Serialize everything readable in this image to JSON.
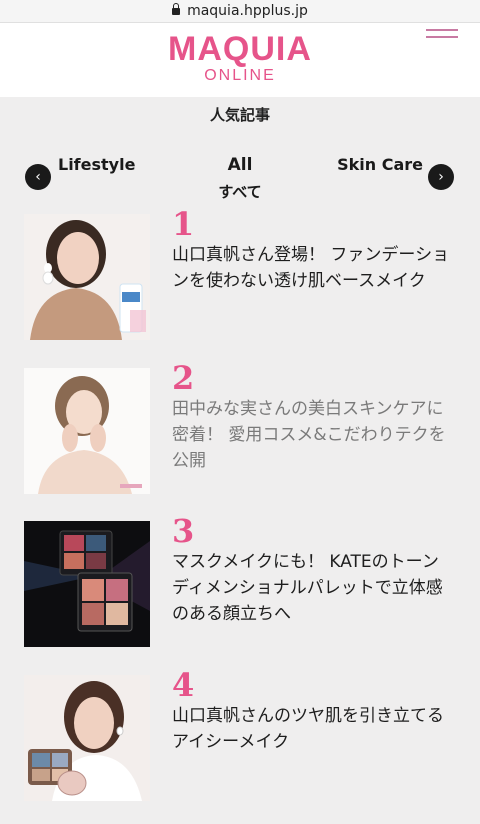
{
  "browser": {
    "url": "maquia.hpplus.jp"
  },
  "header": {
    "logo_main": "MAQUIA",
    "logo_sub": "ONLINE"
  },
  "section": {
    "title": "人気記事"
  },
  "category_nav": {
    "prev_icon": "‹",
    "next_icon": "›",
    "tabs": [
      "Lifestyle",
      "All",
      "Skin Care"
    ],
    "active": "All",
    "active_sub": "すべて"
  },
  "articles": [
    {
      "rank": "1",
      "title": "山口真帆さん登場！ ファンデーションを使わない透け肌ベースメイク",
      "visited": false
    },
    {
      "rank": "2",
      "title": "田中みな実さんの美白スキンケアに密着！ 愛用コスメ&こだわりテクを公開",
      "visited": true
    },
    {
      "rank": "3",
      "title": "マスクメイクにも！ KATEのトーンディメンショナルパレットで立体感のある顔立ちへ",
      "visited": false
    },
    {
      "rank": "4",
      "title": "山口真帆さんのツヤ肌を引き立てるアイシーメイク",
      "visited": false
    }
  ],
  "colors": {
    "accent": "#e6548a",
    "background": "#efeeee"
  }
}
